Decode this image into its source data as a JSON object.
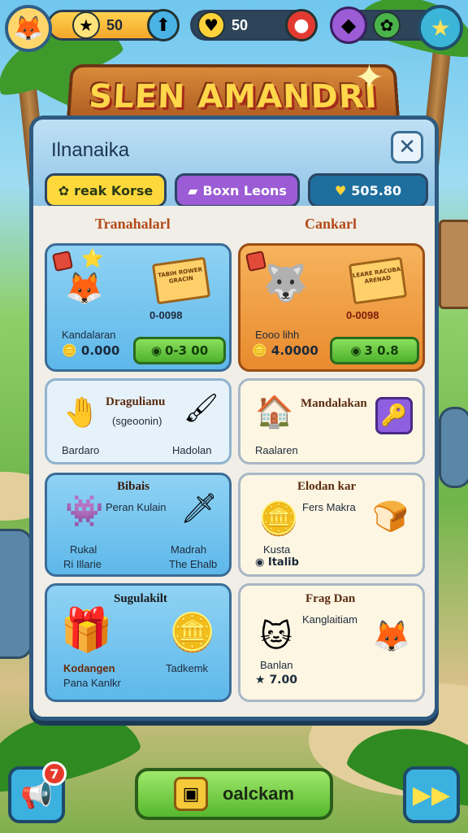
{
  "hud": {
    "avatar_icon": "fox-avatar-icon",
    "stars_value": "50",
    "hearts_value": "50",
    "colors": {
      "gold_bar": "#f4a62a",
      "dark_bar": "#2e4459",
      "settings": "#3bb6d8"
    }
  },
  "banner": {
    "title": "SLEN AMANDRI"
  },
  "panel": {
    "title": "Ilnanaika",
    "tabs": [
      {
        "label": "reak Korse",
        "icon": "clover-icon"
      },
      {
        "label": "Boxn Leons",
        "icon": "ticket-icon"
      },
      {
        "label": "505.80",
        "icon": "heart-icon"
      }
    ],
    "columns": {
      "left": "Tranahalarl",
      "right": "Cankarl"
    }
  },
  "cards": {
    "c1": {
      "ticket_text": "TABIH ROWER GRACIN",
      "price_tag": "0-0098",
      "label": "Kandalaran",
      "coins": "0.000",
      "button": "0-3 00"
    },
    "c2": {
      "ticket_text": "LEARE RACUBA ARENAD",
      "price_tag": "0-0098",
      "label": "Eooo lihh",
      "coins": "4.0000",
      "button": "3 0.8"
    },
    "c3": {
      "title": "Dragulianu",
      "subtitle": "(sgeoonin)",
      "left_label": "Bardaro",
      "right_label": "Hadolan"
    },
    "c4": {
      "title": "Mandalakan",
      "left_label": "Raalaren"
    },
    "c5": {
      "title": "Bibais",
      "subtitle": "Peran Kulain",
      "left_label_1": "Rukal",
      "left_label_2": "Ri Illarie",
      "right_label_1": "Madrah",
      "right_label_2": "The Ehalb"
    },
    "c6": {
      "title": "Elodan kar",
      "subtitle": "Fers Makra",
      "label": "Kusta",
      "coins": "Italib"
    },
    "c7": {
      "title": "Sugulakilt",
      "left_label_1": "Kodangen",
      "left_label_2": "Pana Kanlkr",
      "right_label": "Tadkemk"
    },
    "c8": {
      "title": "Frag Dan",
      "subtitle": "Kanglaitiam",
      "label": "Banlan",
      "coins": "7.00"
    }
  },
  "bottom": {
    "notification_count": "7",
    "collect_label": "oalckam"
  }
}
